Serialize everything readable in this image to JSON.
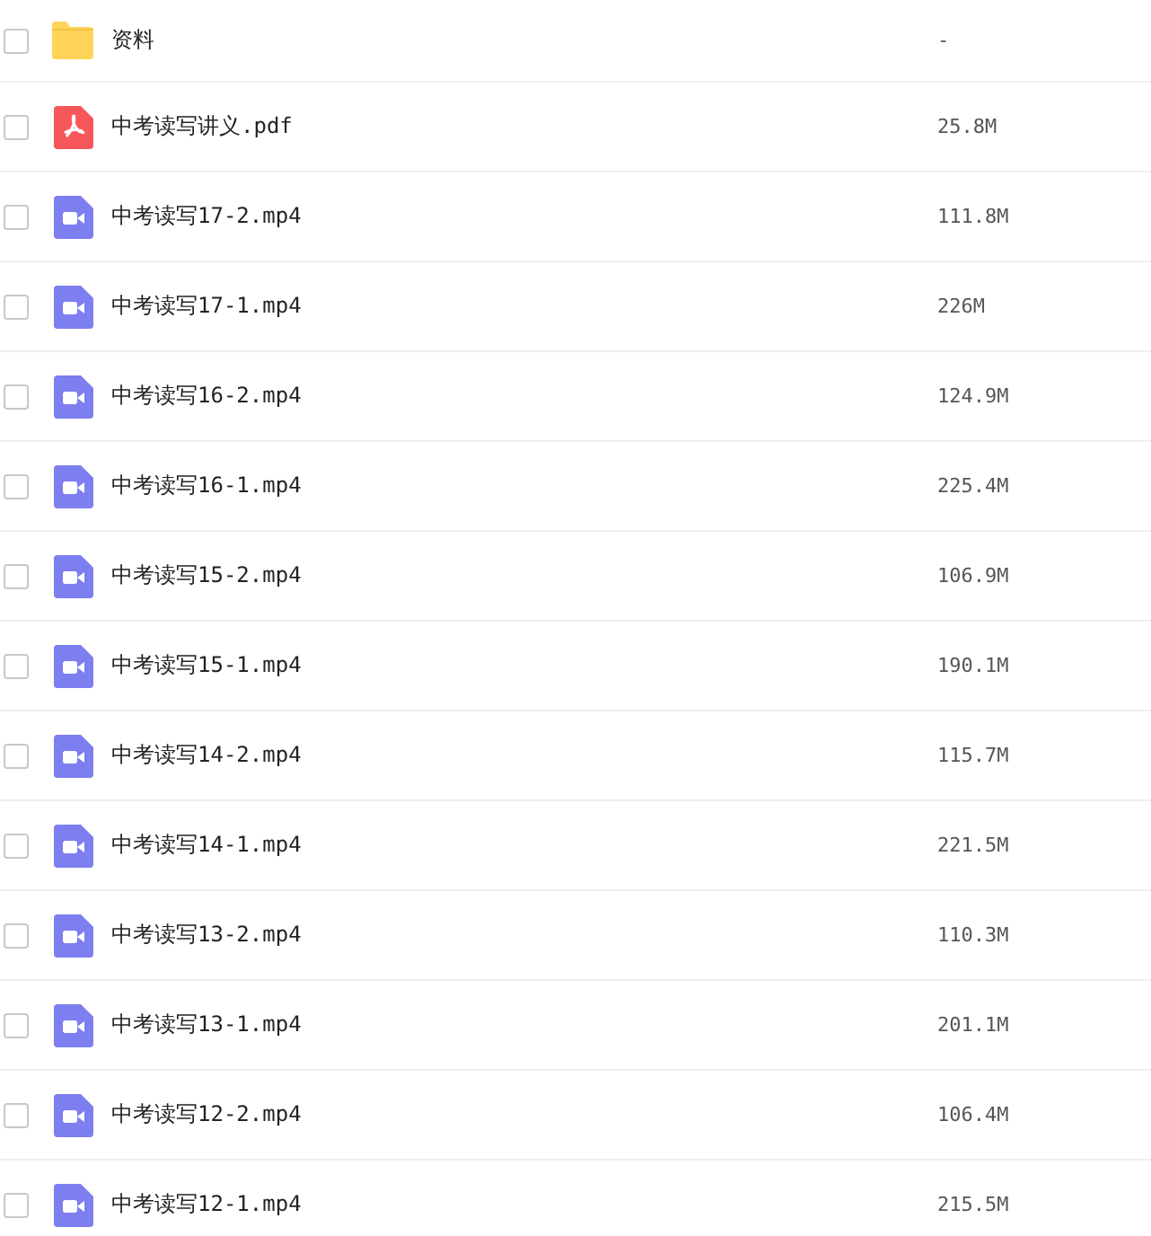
{
  "files": [
    {
      "kind": "folder",
      "name": "资料",
      "size": "-",
      "checked": false
    },
    {
      "kind": "pdf",
      "name": "中考读写讲义.pdf",
      "size": "25.8M",
      "checked": false
    },
    {
      "kind": "video",
      "name": "中考读写17-2.mp4",
      "size": "111.8M",
      "checked": false
    },
    {
      "kind": "video",
      "name": "中考读写17-1.mp4",
      "size": "226M",
      "checked": false
    },
    {
      "kind": "video",
      "name": "中考读写16-2.mp4",
      "size": "124.9M",
      "checked": false
    },
    {
      "kind": "video",
      "name": "中考读写16-1.mp4",
      "size": "225.4M",
      "checked": false
    },
    {
      "kind": "video",
      "name": "中考读写15-2.mp4",
      "size": "106.9M",
      "checked": false
    },
    {
      "kind": "video",
      "name": "中考读写15-1.mp4",
      "size": "190.1M",
      "checked": false
    },
    {
      "kind": "video",
      "name": "中考读写14-2.mp4",
      "size": "115.7M",
      "checked": false
    },
    {
      "kind": "video",
      "name": "中考读写14-1.mp4",
      "size": "221.5M",
      "checked": false
    },
    {
      "kind": "video",
      "name": "中考读写13-2.mp4",
      "size": "110.3M",
      "checked": false
    },
    {
      "kind": "video",
      "name": "中考读写13-1.mp4",
      "size": "201.1M",
      "checked": false
    },
    {
      "kind": "video",
      "name": "中考读写12-2.mp4",
      "size": "106.4M",
      "checked": false
    },
    {
      "kind": "video",
      "name": "中考读写12-1.mp4",
      "size": "215.5M",
      "checked": false
    }
  ]
}
